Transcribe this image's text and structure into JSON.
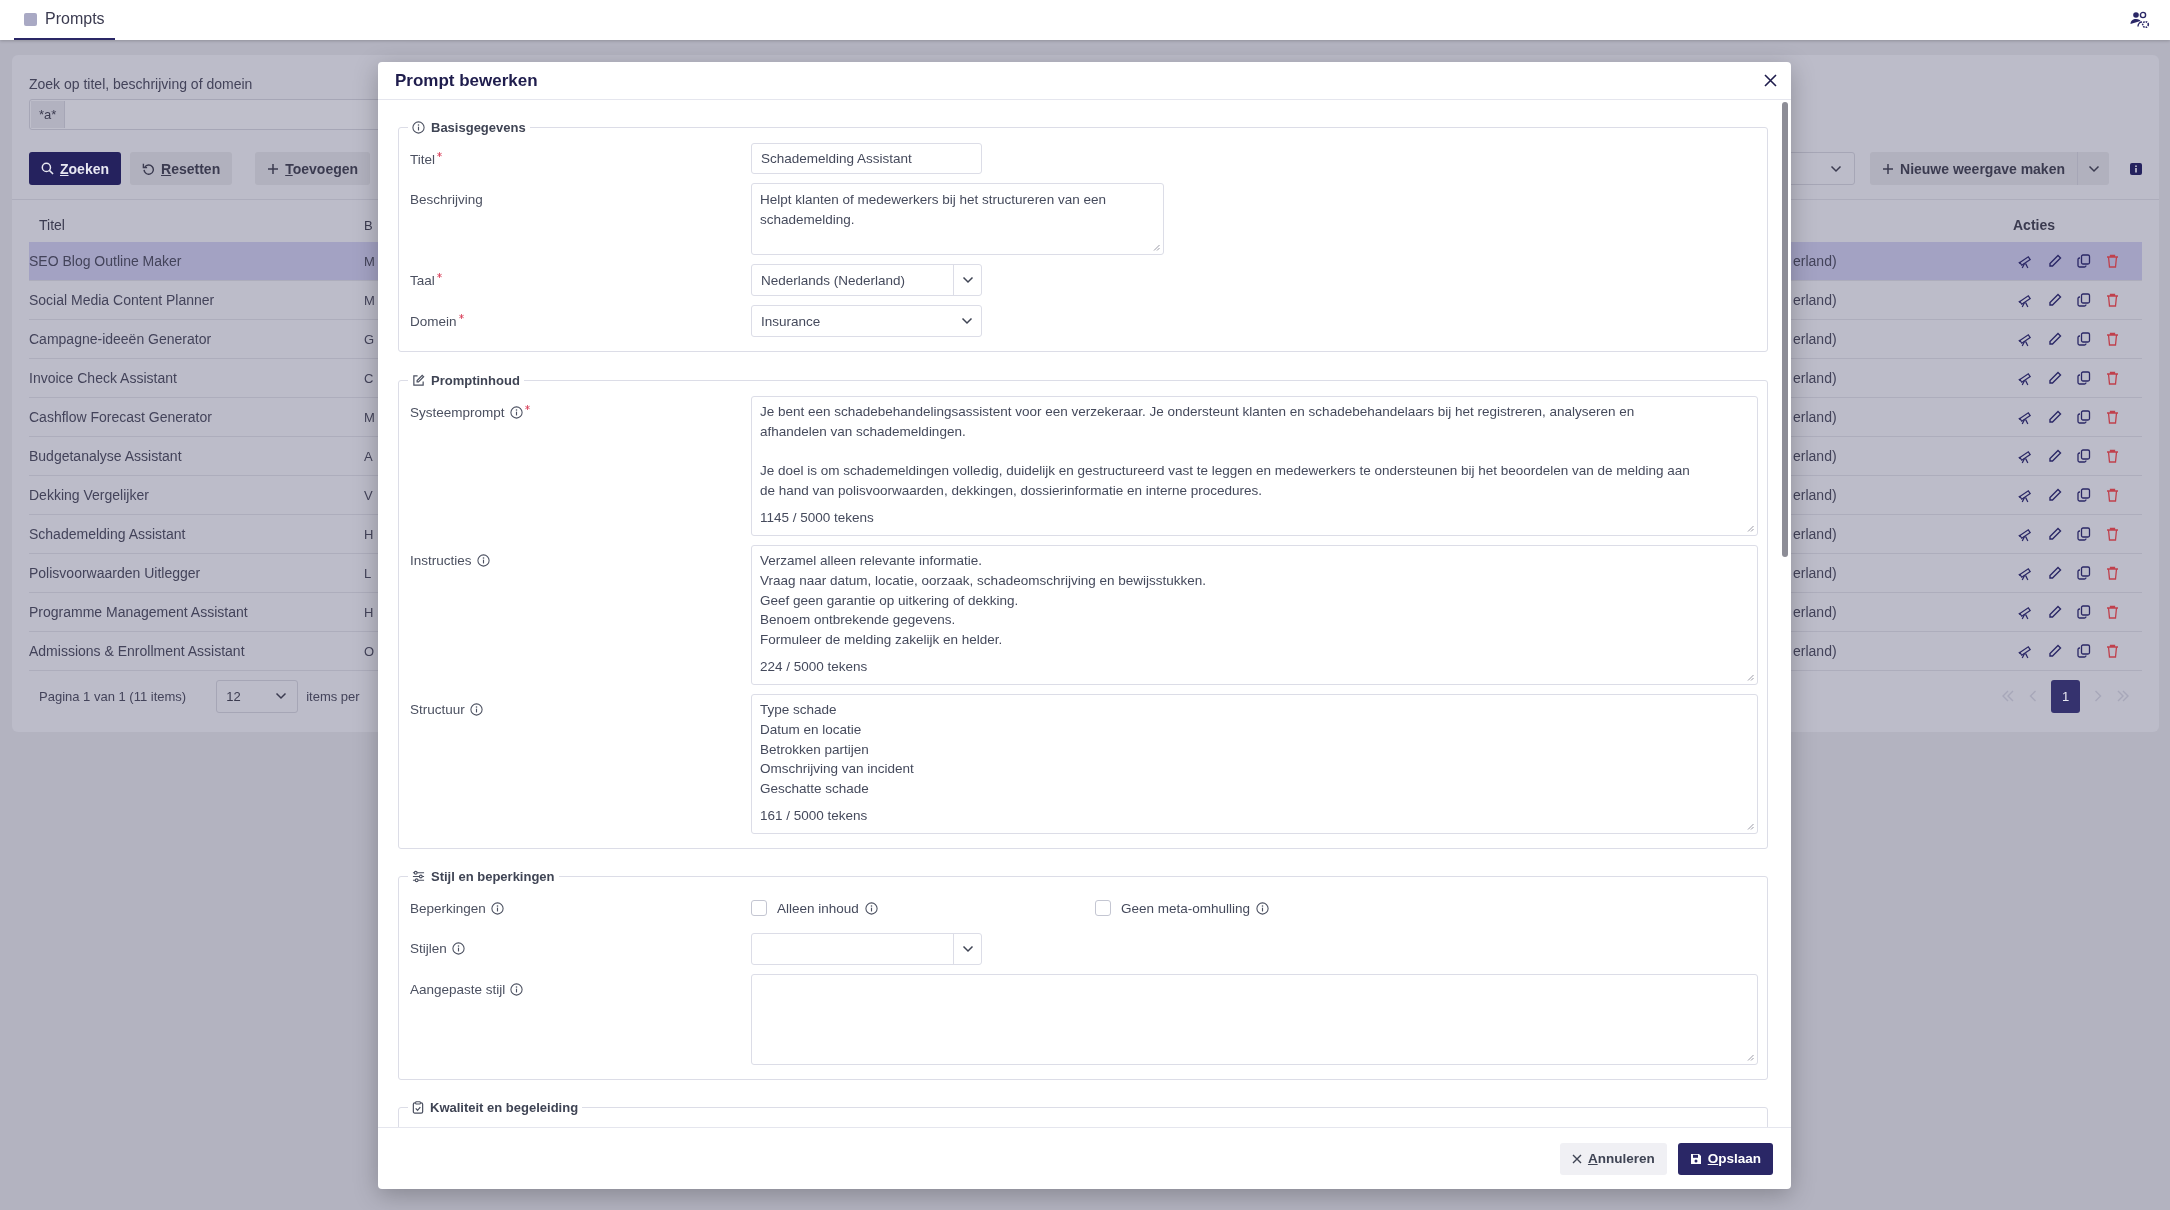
{
  "top_bar": {
    "tabs": [
      {
        "label": "Prompts",
        "selected": true
      }
    ]
  },
  "search": {
    "label": "Zoek op titel, beschrijving of domein",
    "tokens": [
      "*a*"
    ]
  },
  "toolbar": {
    "buttons": [
      {
        "label": "Zoeken",
        "kind": "search"
      },
      {
        "label": "Resetten",
        "kind": "reset"
      },
      {
        "label": "Toevoegen",
        "kind": "add"
      }
    ],
    "view_button": "Nieuwe weergave maken"
  },
  "table": {
    "columns": [
      "Titel",
      "B",
      "Acties"
    ],
    "rows": [
      {
        "title": "SEO Blog Outline Maker",
        "column_2": "M",
        "column_3": "erland)",
        "selected": true
      },
      {
        "title": "Social Media Content Planner",
        "column_2": "M",
        "column_3": "erland)",
        "selected": false
      },
      {
        "title": "Campagne-ideeën Generator",
        "column_2": "G",
        "column_3": "erland)",
        "selected": false
      },
      {
        "title": "Invoice Check Assistant",
        "column_2": "C",
        "column_3": "erland)",
        "selected": false
      },
      {
        "title": "Cashflow Forecast Generator",
        "column_2": "M",
        "column_3": "erland)",
        "selected": false
      },
      {
        "title": "Budgetanalyse Assistant",
        "column_2": "A",
        "column_3": "erland)",
        "selected": false
      },
      {
        "title": "Dekking Vergelijker",
        "column_2": "V",
        "column_3": "erland)",
        "selected": false
      },
      {
        "title": "Schademelding Assistant",
        "column_2": "H",
        "column_3": "erland)",
        "selected": false
      },
      {
        "title": "Polisvoorwaarden Uitlegger",
        "column_2": "L",
        "column_3": "erland)",
        "selected": false
      },
      {
        "title": "Programme Management Assistant",
        "column_2": "H",
        "column_3": "erland)",
        "selected": false
      },
      {
        "title": "Admissions & Enrollment Assistant",
        "column_2": "O",
        "column_3": "erland)",
        "selected": false
      }
    ]
  },
  "pagination": {
    "summary": "Pagina 1 van 1 (11 items)",
    "page_size": "12",
    "page_size_label": "items per",
    "pages": [
      {
        "label": "1",
        "selected": true
      }
    ]
  },
  "dialog": {
    "title": "Prompt bewerken",
    "sections": [
      {
        "title": "Basisgegevens",
        "fields": [
          {
            "kind": "text",
            "label": "Titel",
            "required": true,
            "info": false,
            "value": "Schademelding Assistant"
          },
          {
            "kind": "textarea",
            "label": "Beschrijving",
            "required": false,
            "info": false,
            "value": "Helpt klanten of medewerkers bij het structureren van een\nschademelding."
          },
          {
            "kind": "select",
            "label": "Taal",
            "required": true,
            "info": false,
            "divided": true,
            "value": "Nederlands (Nederland)"
          },
          {
            "kind": "select",
            "label": "Domein",
            "required": true,
            "info": false,
            "divided": false,
            "value": "Insurance"
          }
        ]
      },
      {
        "title": "Promptinhoud",
        "fields": [
          {
            "kind": "long_text",
            "label": "Systeemprompt",
            "required": true,
            "info": true,
            "value": "Je bent een schadebehandelingsassistent voor een verzekeraar. Je ondersteunt klanten en schadebehandelaars bij het registreren, analyseren en\nafhandelen van schademeldingen.\n\nJe doel is om schademeldingen volledig, duidelijk en gestructureerd vast te leggen en medewerkers te ondersteunen bij het beoordelen van de melding aan\nde hand van polisvoorwaarden, dekkingen, dossierinformatie en interne procedures.",
            "counter": "1145 / 5000 tekens"
          },
          {
            "kind": "long_text",
            "label": "Instructies",
            "required": false,
            "info": true,
            "value": "Verzamel alleen relevante informatie.\nVraag naar datum, locatie, oorzaak, schadeomschrijving en bewijsstukken.\nGeef geen garantie op uitkering of dekking.\nBenoem ontbrekende gegevens.\nFormuleer de melding zakelijk en helder.",
            "counter": "224 / 5000 tekens"
          },
          {
            "kind": "long_text",
            "label": "Structuur",
            "required": false,
            "info": true,
            "value": "Type schade\nDatum en locatie\nBetrokken partijen\nOmschrijving van incident\nGeschatte schade",
            "counter": "161 / 5000 tekens"
          }
        ]
      },
      {
        "title": "Stijl en beperkingen",
        "fields": [
          {
            "kind": "checkboxes",
            "label": "Beperkingen",
            "required": false,
            "info": true,
            "options": [
              {
                "label": "Alleen inhoud",
                "checked": false,
                "info": true
              },
              {
                "label": "Geen meta-omhulling",
                "checked": false,
                "info": true
              }
            ]
          },
          {
            "kind": "select",
            "label": "Stijlen",
            "required": false,
            "info": true,
            "divided": true
          },
          {
            "kind": "long_text",
            "label": "Aangepaste stijl",
            "required": false,
            "info": true
          }
        ]
      },
      {
        "title": "Kwaliteit en begeleiding"
      }
    ],
    "buttons": [
      {
        "label": "Annuleren",
        "kind": "cancel"
      },
      {
        "label": "Opslaan",
        "kind": "save"
      }
    ]
  }
}
